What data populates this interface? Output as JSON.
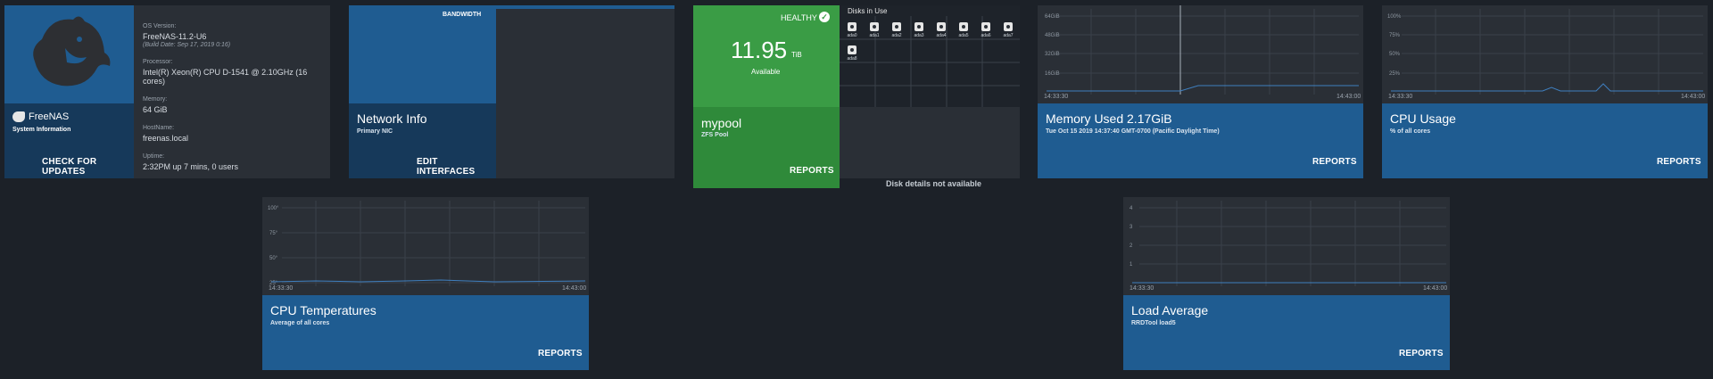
{
  "sysinfo": {
    "brand": "FreeNAS",
    "card_label": "System Information",
    "check_updates": "CHECK FOR UPDATES",
    "os_version_label": "OS Version:",
    "os_version": "FreeNAS-11.2-U6",
    "build_date": "(Build Date: Sep 17, 2019 0:16)",
    "processor_label": "Processor:",
    "processor": "Intel(R) Xeon(R) CPU D-1541 @ 2.10GHz (16 cores)",
    "memory_label": "Memory:",
    "memory": "64 GiB",
    "hostname_label": "HostName:",
    "hostname": "freenas.local",
    "uptime_label": "Uptime:",
    "uptime": "2:32PM up 7 mins, 0 users"
  },
  "network": {
    "bandwidth": "BANDWIDTH",
    "title": "Network Info",
    "subtitle": "Primary NIC",
    "edit": "EDIT INTERFACES"
  },
  "pool": {
    "status": "HEALTHY",
    "size": "11.95",
    "unit": "TiB",
    "available": "Available",
    "name": "mypool",
    "type": "ZFS Pool",
    "reports": "REPORTS",
    "disks_title": "Disks in Use",
    "disks": [
      "ada0",
      "ada1",
      "ada2",
      "ada3",
      "ada4",
      "ada5",
      "ada6",
      "ada7",
      "ada8"
    ],
    "disk_details": "Disk details not available",
    "colors": {
      "healthy": "#3a9c45",
      "healthy_dark": "#2f8a3a"
    }
  },
  "memory": {
    "title": "Memory Used 2.17GiB",
    "subtitle": "Tue Oct 15 2019 14:37:40 GMT-0700 (Pacific Daylight Time)",
    "reports": "REPORTS",
    "y_ticks": [
      "64GiB",
      "48GiB",
      "32GiB",
      "16GiB"
    ],
    "t_start": "14:33:30",
    "t_end": "14:43:00"
  },
  "cpu": {
    "title": "CPU Usage",
    "subtitle": "% of all cores",
    "reports": "REPORTS",
    "y_ticks": [
      "100%",
      "75%",
      "50%",
      "25%"
    ],
    "t_start": "14:33:30",
    "t_end": "14:43:00"
  },
  "temps": {
    "title": "CPU Temperatures",
    "subtitle": "Average of all cores",
    "reports": "REPORTS",
    "y_ticks": [
      "100°",
      "75°",
      "50°",
      "25°"
    ],
    "t_start": "14:33:30",
    "t_end": "14:43:00"
  },
  "load": {
    "title": "Load Average",
    "subtitle": "RRDTool load5",
    "reports": "REPORTS",
    "y_ticks": [
      "4",
      "3",
      "2",
      "1"
    ],
    "t_start": "14:33:30",
    "t_end": "14:43:00"
  }
}
